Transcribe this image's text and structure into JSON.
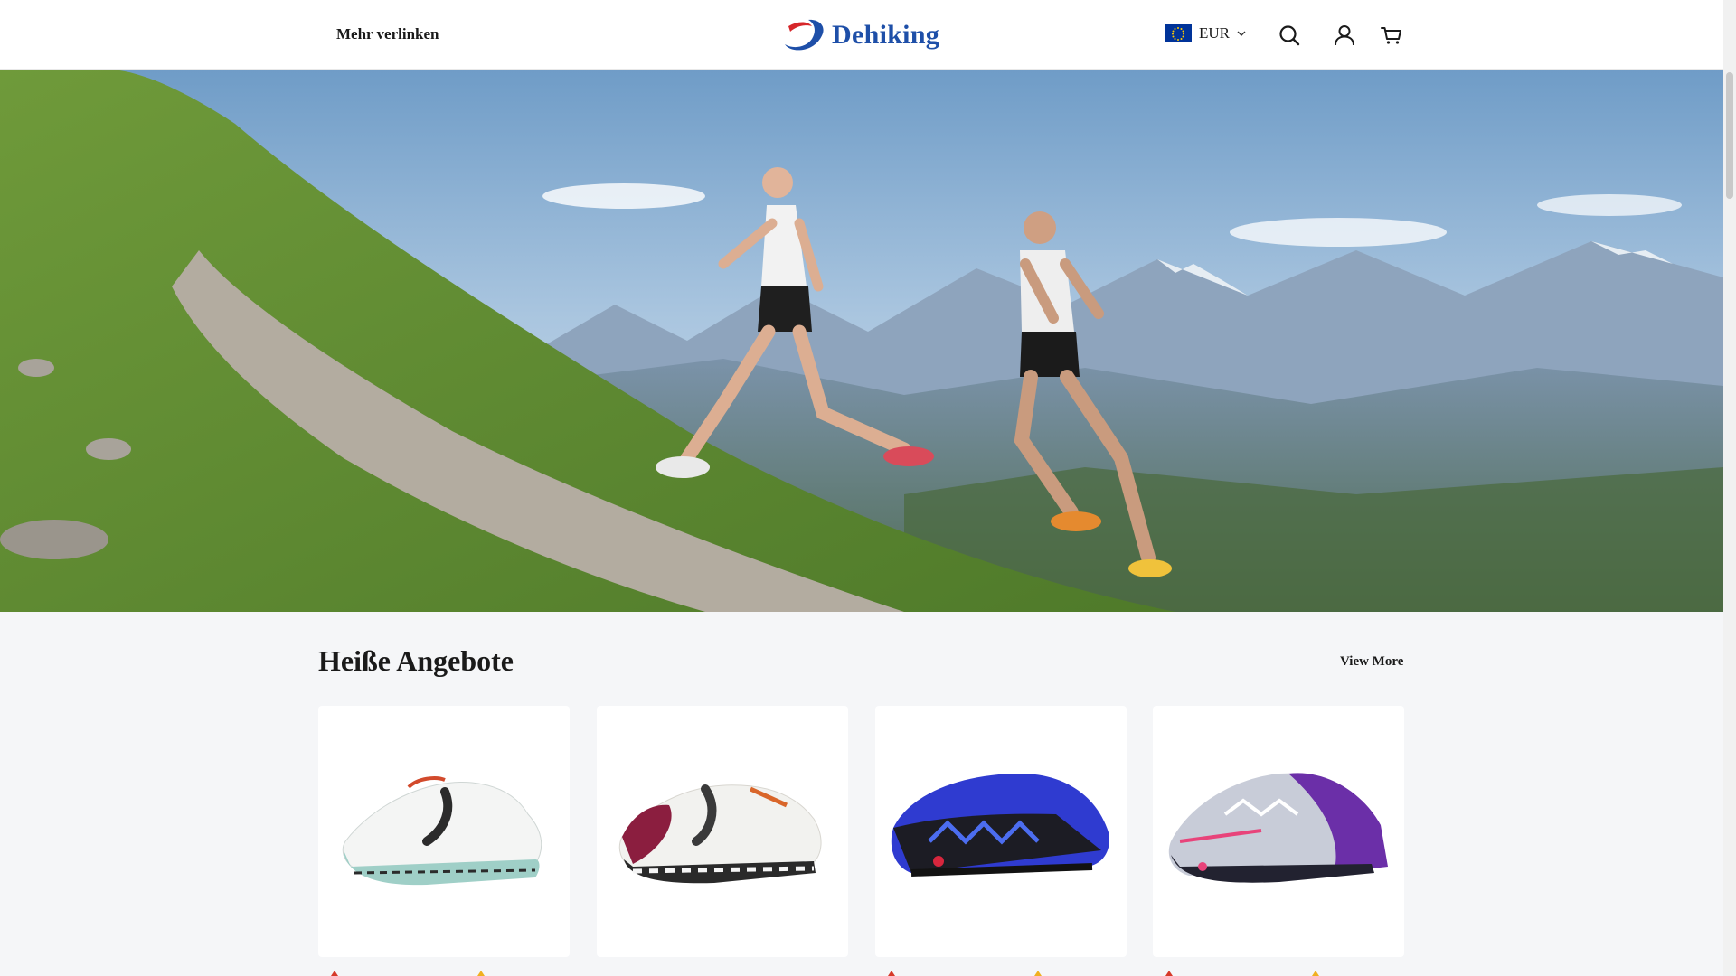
{
  "header": {
    "nav_link": "Mehr verlinken",
    "logo_text": "Dehiking",
    "currency": "EUR",
    "icons": [
      "search-icon",
      "user-icon",
      "cart-icon"
    ],
    "brand_color": "#1e4fa8"
  },
  "hero": {
    "image": "trail-runners-mountain-photo"
  },
  "section": {
    "title": "Heiße Angebote",
    "view_more": "View More"
  },
  "products": [
    {
      "image": "white-mint-running-shoe"
    },
    {
      "image": "white-burgundy-running-shoe"
    },
    {
      "image": "blue-black-trail-shoe"
    },
    {
      "image": "grey-purple-trail-shoe"
    }
  ]
}
